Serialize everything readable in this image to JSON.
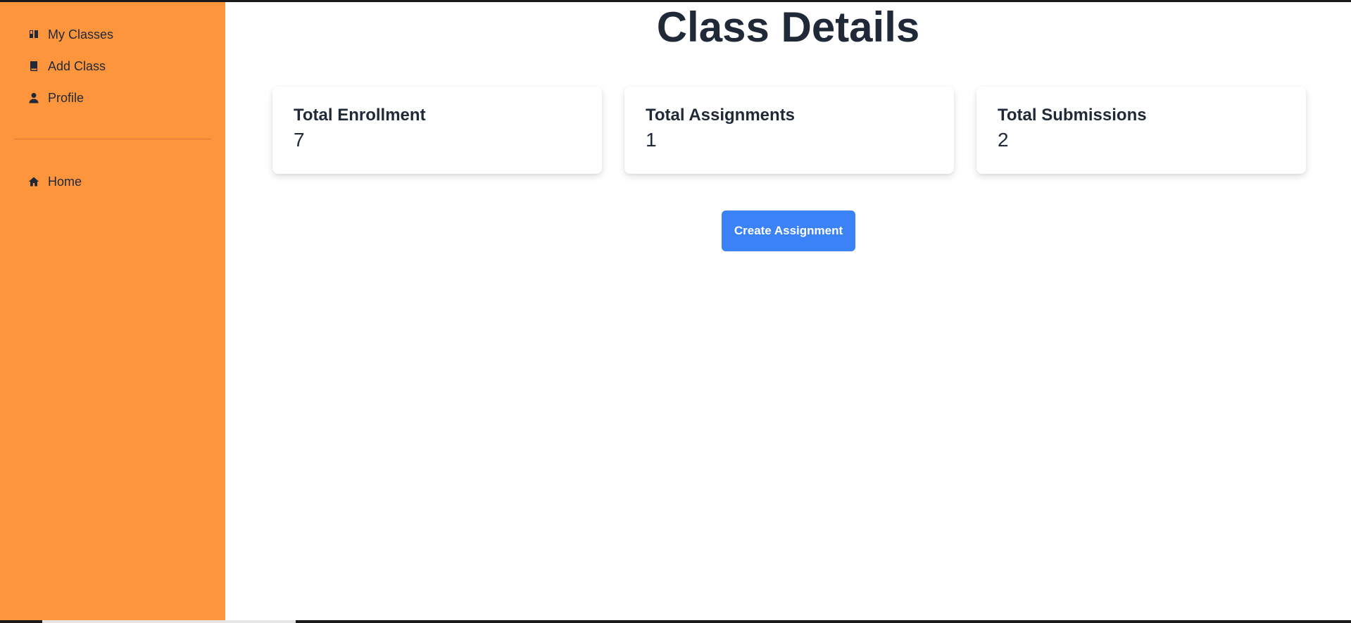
{
  "sidebar": {
    "items": [
      {
        "label": "My Classes",
        "icon": "book-open-icon"
      },
      {
        "label": "Add Class",
        "icon": "book-icon"
      },
      {
        "label": "Profile",
        "icon": "user-icon"
      }
    ],
    "secondary_items": [
      {
        "label": "Home",
        "icon": "home-icon"
      }
    ],
    "background_color": "#fd953d"
  },
  "main": {
    "title": "Class Details",
    "stats": [
      {
        "label": "Total Enrollment",
        "value": "7"
      },
      {
        "label": "Total Assignments",
        "value": "1"
      },
      {
        "label": "Total Submissions",
        "value": "2"
      }
    ],
    "create_button_label": "Create Assignment",
    "accent_color": "#3b82f6"
  }
}
